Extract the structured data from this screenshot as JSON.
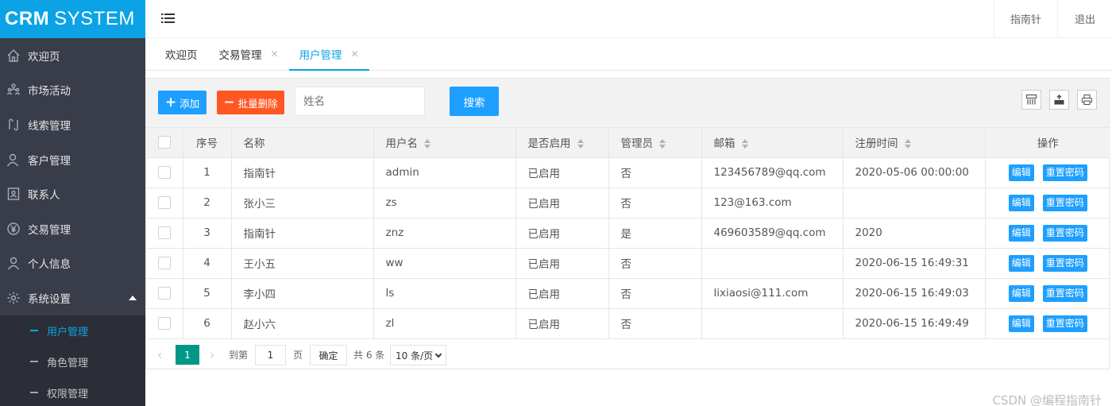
{
  "app": {
    "logo_bold": "CRM",
    "logo_rest": "SYSTEM"
  },
  "sidebar": {
    "items": [
      {
        "label": "欢迎页",
        "icon": "home-icon"
      },
      {
        "label": "市场活动",
        "icon": "group-icon"
      },
      {
        "label": "线索管理",
        "icon": "clue-icon"
      },
      {
        "label": "客户管理",
        "icon": "customer-icon"
      },
      {
        "label": "联系人",
        "icon": "contact-icon"
      },
      {
        "label": "交易管理",
        "icon": "yuan-icon"
      },
      {
        "label": "个人信息",
        "icon": "user-icon"
      },
      {
        "label": "系统设置",
        "icon": "gear-icon",
        "expanded": true
      }
    ],
    "subitems": [
      {
        "label": "用户管理",
        "active": true
      },
      {
        "label": "角色管理",
        "active": false
      },
      {
        "label": "权限管理",
        "active": false
      }
    ]
  },
  "header": {
    "user": "指南针",
    "logout": "退出"
  },
  "tabs": [
    {
      "label": "欢迎页",
      "closable": false,
      "active": false
    },
    {
      "label": "交易管理",
      "closable": true,
      "active": false
    },
    {
      "label": "用户管理",
      "closable": true,
      "active": true
    }
  ],
  "toolbar": {
    "add_label": "添加",
    "batch_delete_label": "批量删除",
    "search_placeholder": "姓名",
    "search_value": "",
    "search_button": "搜索"
  },
  "table": {
    "columns": [
      "序号",
      "名称",
      "用户名",
      "是否启用",
      "管理员",
      "邮箱",
      "注册时间",
      "操作"
    ],
    "sortable": [
      false,
      false,
      true,
      true,
      true,
      true,
      true,
      false
    ],
    "rows": [
      {
        "index": "1",
        "name": "指南针",
        "username": "admin",
        "enabled": "已启用",
        "admin": "否",
        "email": "123456789@qq.com",
        "registered": "2020-05-06 00:00:00"
      },
      {
        "index": "2",
        "name": "张小三",
        "username": "zs",
        "enabled": "已启用",
        "admin": "否",
        "email": "123@163.com",
        "registered": ""
      },
      {
        "index": "3",
        "name": "指南针",
        "username": "znz",
        "enabled": "已启用",
        "admin": "是",
        "email": "469603589@qq.com",
        "registered": "2020"
      },
      {
        "index": "4",
        "name": "王小五",
        "username": "ww",
        "enabled": "已启用",
        "admin": "否",
        "email": "",
        "registered": "2020-06-15 16:49:31"
      },
      {
        "index": "5",
        "name": "李小四",
        "username": "ls",
        "enabled": "已启用",
        "admin": "否",
        "email": "lixiaosi@111.com",
        "registered": "2020-06-15 16:49:03"
      },
      {
        "index": "6",
        "name": "赵小六",
        "username": "zl",
        "enabled": "已启用",
        "admin": "否",
        "email": "",
        "registered": "2020-06-15 16:49:49"
      }
    ],
    "edit_label": "编辑",
    "reset_label": "重置密码"
  },
  "pager": {
    "current_page": "1",
    "goto_prefix": "到第",
    "goto_value": "1",
    "goto_suffix": "页",
    "confirm": "确定",
    "total": "共 6 条",
    "page_size": "10 条/页"
  },
  "watermark": "CSDN @编程指南针",
  "colors": {
    "accent": "#0ba3e6",
    "primary_button": "#1e9fff",
    "danger_button": "#ff5722",
    "pager_active": "#009688",
    "sidebar_bg": "#393d49"
  }
}
